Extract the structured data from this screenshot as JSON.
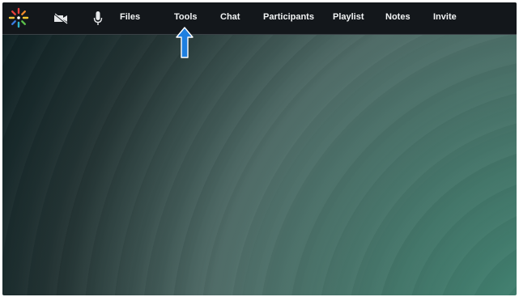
{
  "topbar": {
    "logo_icon": "spark-logo-icon",
    "video_icon": "video-off-icon",
    "mic_icon": "microphone-icon",
    "nav": [
      {
        "label": "Files"
      },
      {
        "label": "Tools"
      },
      {
        "label": "Chat"
      },
      {
        "label": "Participants"
      },
      {
        "label": "Playlist"
      },
      {
        "label": "Notes"
      },
      {
        "label": "Invite"
      }
    ]
  },
  "annotation": {
    "icon": "up-arrow-icon",
    "color": "#1e7fe0"
  },
  "colors": {
    "topbar_bg": "#13171b",
    "stage_dark": "#0d1f22",
    "stage_light": "#2f7a66"
  }
}
